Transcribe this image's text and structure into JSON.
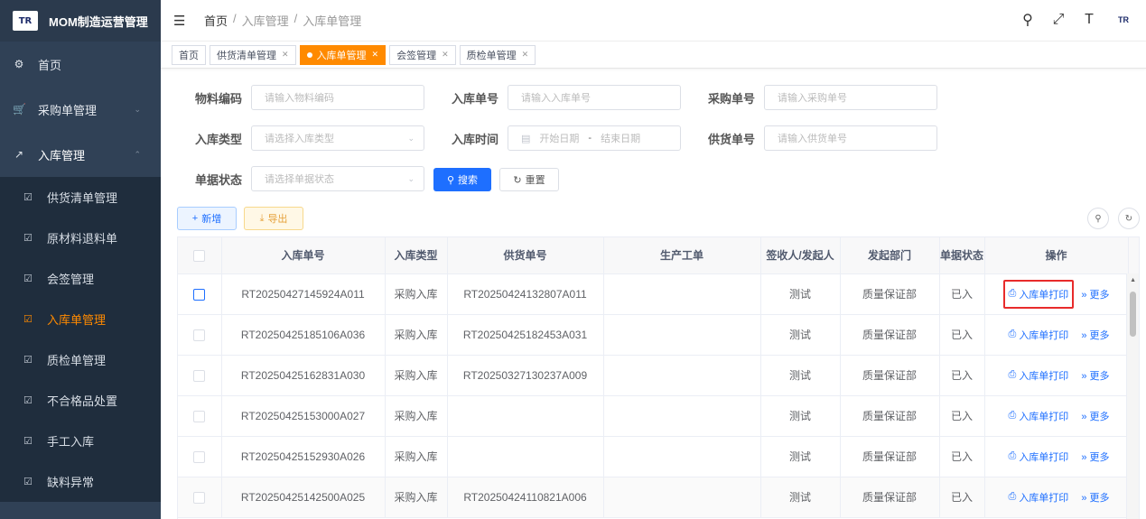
{
  "app": {
    "title": "MOM制造运营管理",
    "logo_text": "TR"
  },
  "sidebar": {
    "items": [
      {
        "label": "首页",
        "icon": "dashboard-icon"
      },
      {
        "label": "采购单管理",
        "icon": "cart-icon"
      },
      {
        "label": "入库管理",
        "icon": "external-link-icon"
      }
    ],
    "sub_items": [
      {
        "label": "供货清单管理"
      },
      {
        "label": "原材料退料单"
      },
      {
        "label": "会签管理"
      },
      {
        "label": "入库单管理"
      },
      {
        "label": "质检单管理"
      },
      {
        "label": "不合格品处置"
      },
      {
        "label": "手工入库"
      },
      {
        "label": "缺料异常"
      }
    ]
  },
  "header": {
    "breadcrumb": [
      "首页",
      "入库管理",
      "入库单管理"
    ]
  },
  "tabs": [
    {
      "label": "首页"
    },
    {
      "label": "供货清单管理"
    },
    {
      "label": "入库单管理"
    },
    {
      "label": "会签管理"
    },
    {
      "label": "质检单管理"
    }
  ],
  "search": {
    "material_code": {
      "label": "物料编码",
      "placeholder": "请输入物料编码"
    },
    "inbound_no": {
      "label": "入库单号",
      "placeholder": "请输入入库单号"
    },
    "purchase_no": {
      "label": "采购单号",
      "placeholder": "请输入采购单号"
    },
    "inbound_type": {
      "label": "入库类型",
      "placeholder": "请选择入库类型"
    },
    "inbound_time": {
      "label": "入库时间",
      "start": "开始日期",
      "sep": "-",
      "end": "结束日期"
    },
    "supply_no": {
      "label": "供货单号",
      "placeholder": "请输入供货单号"
    },
    "doc_status": {
      "label": "单据状态",
      "placeholder": "请选择单据状态"
    },
    "search_btn": "搜索",
    "reset_btn": "重置"
  },
  "toolbar": {
    "add": "新增",
    "export": "导出"
  },
  "table": {
    "columns": [
      "入库单号",
      "入库类型",
      "供货单号",
      "生产工单",
      "签收人/发起人",
      "发起部门",
      "单据状态",
      "操作"
    ],
    "rows": [
      {
        "no": "RT20250427145924A011",
        "type": "采购入库",
        "supply": "RT20250424132807A011",
        "work": "",
        "signer": "测试",
        "dept": "质量保证部",
        "status": "已入"
      },
      {
        "no": "RT20250425185106A036",
        "type": "采购入库",
        "supply": "RT20250425182453A031",
        "work": "",
        "signer": "测试",
        "dept": "质量保证部",
        "status": "已入"
      },
      {
        "no": "RT20250425162831A030",
        "type": "采购入库",
        "supply": "RT20250327130237A009",
        "work": "",
        "signer": "测试",
        "dept": "质量保证部",
        "status": "已入"
      },
      {
        "no": "RT20250425153000A027",
        "type": "采购入库",
        "supply": "",
        "work": "",
        "signer": "测试",
        "dept": "质量保证部",
        "status": "已入"
      },
      {
        "no": "RT20250425152930A026",
        "type": "采购入库",
        "supply": "",
        "work": "",
        "signer": "测试",
        "dept": "质量保证部",
        "status": "已入"
      },
      {
        "no": "RT20250425142500A025",
        "type": "采购入库",
        "supply": "RT20250424110821A006",
        "work": "",
        "signer": "测试",
        "dept": "质量保证部",
        "status": "已入"
      }
    ],
    "op_print": "入库单打印",
    "op_more": "更多"
  },
  "colors": {
    "accent": "#ff8a00",
    "primary": "#1e6fff",
    "sidebar": "#304156",
    "highlight": "#e82b2b"
  }
}
